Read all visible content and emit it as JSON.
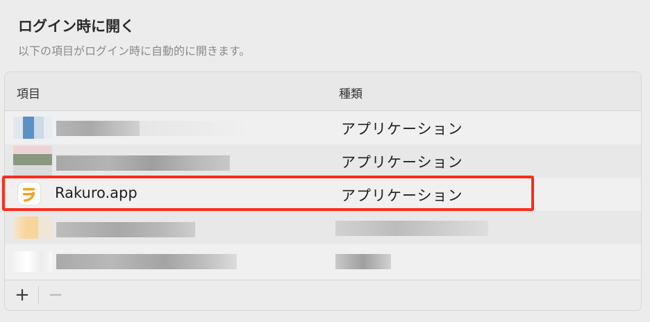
{
  "section": {
    "title": "ログイン時に開く",
    "subtitle": "以下の項目がログイン時に自動的に開きます。"
  },
  "table": {
    "columns": {
      "item": "項目",
      "kind": "種類"
    },
    "rows": [
      {
        "name": "",
        "kind": "アプリケーション",
        "obscured": true
      },
      {
        "name": "",
        "kind": "アプリケーション",
        "obscured": true
      },
      {
        "name": "Rakuro.app",
        "kind": "アプリケーション",
        "obscured": false,
        "highlighted": true,
        "icon": "rakuro-app-icon"
      },
      {
        "name": "",
        "kind": "",
        "obscured": true
      },
      {
        "name": "",
        "kind": "",
        "obscured": true
      }
    ]
  },
  "footer": {
    "add_label": "+",
    "remove_label": "−"
  },
  "colors": {
    "highlight_border": "#ff2a1a",
    "rakuro_orange": "#f5a11c"
  }
}
